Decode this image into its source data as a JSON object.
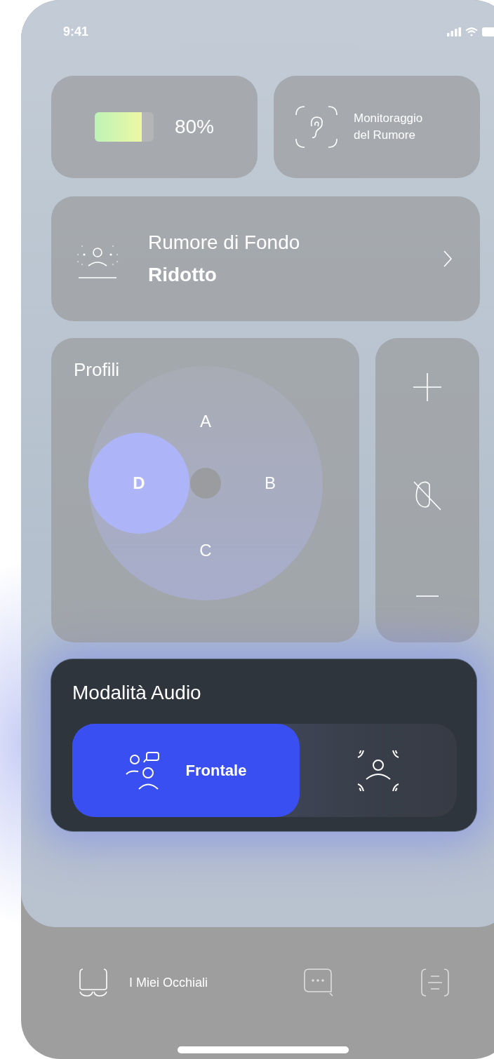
{
  "status_bar": {
    "time": "9:41"
  },
  "battery": {
    "percent": "80%",
    "level": 0.8
  },
  "noise_monitoring": {
    "label": "Monitoraggio del Rumore"
  },
  "background_noise": {
    "title": "Rumore di Fondo",
    "value": "Ridotto"
  },
  "profiles": {
    "title": "Profili",
    "items": [
      {
        "label": "A",
        "selected": false
      },
      {
        "label": "B",
        "selected": false
      },
      {
        "label": "C",
        "selected": false
      },
      {
        "label": "D",
        "selected": true
      }
    ]
  },
  "audio_mode": {
    "title": "Modalità Audio",
    "options": [
      {
        "kind": "front",
        "label": "Frontale",
        "selected": true
      },
      {
        "kind": "surround",
        "selected": false
      }
    ]
  },
  "tab_bar": {
    "items": [
      {
        "kind": "glasses",
        "label": "I Miei Occhiali",
        "selected": true
      },
      {
        "kind": "chat",
        "selected": false
      },
      {
        "kind": "list",
        "selected": false
      }
    ]
  }
}
